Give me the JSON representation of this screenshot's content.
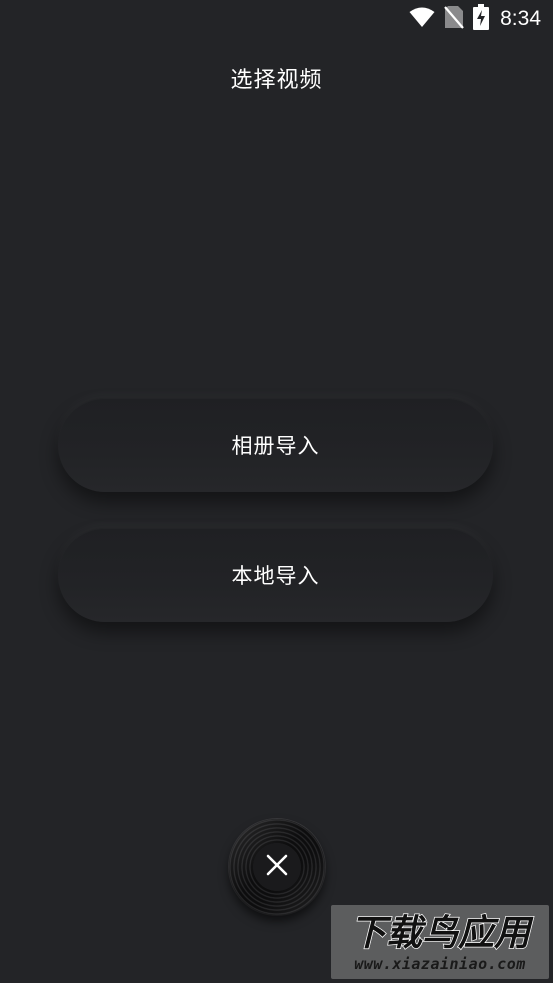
{
  "status_bar": {
    "time": "8:34",
    "icons": [
      "wifi-icon",
      "no-sim-icon",
      "battery-charging-icon"
    ]
  },
  "header": {
    "title": "选择视频"
  },
  "actions": {
    "album_import_label": "相册导入",
    "local_import_label": "本地导入"
  },
  "close_button": {
    "icon": "close-icon"
  },
  "watermark": {
    "logo_text": "下载鸟应用",
    "url": "www.xiazainiao.com"
  },
  "colors": {
    "background": "#232427",
    "text": "#ffffff"
  }
}
